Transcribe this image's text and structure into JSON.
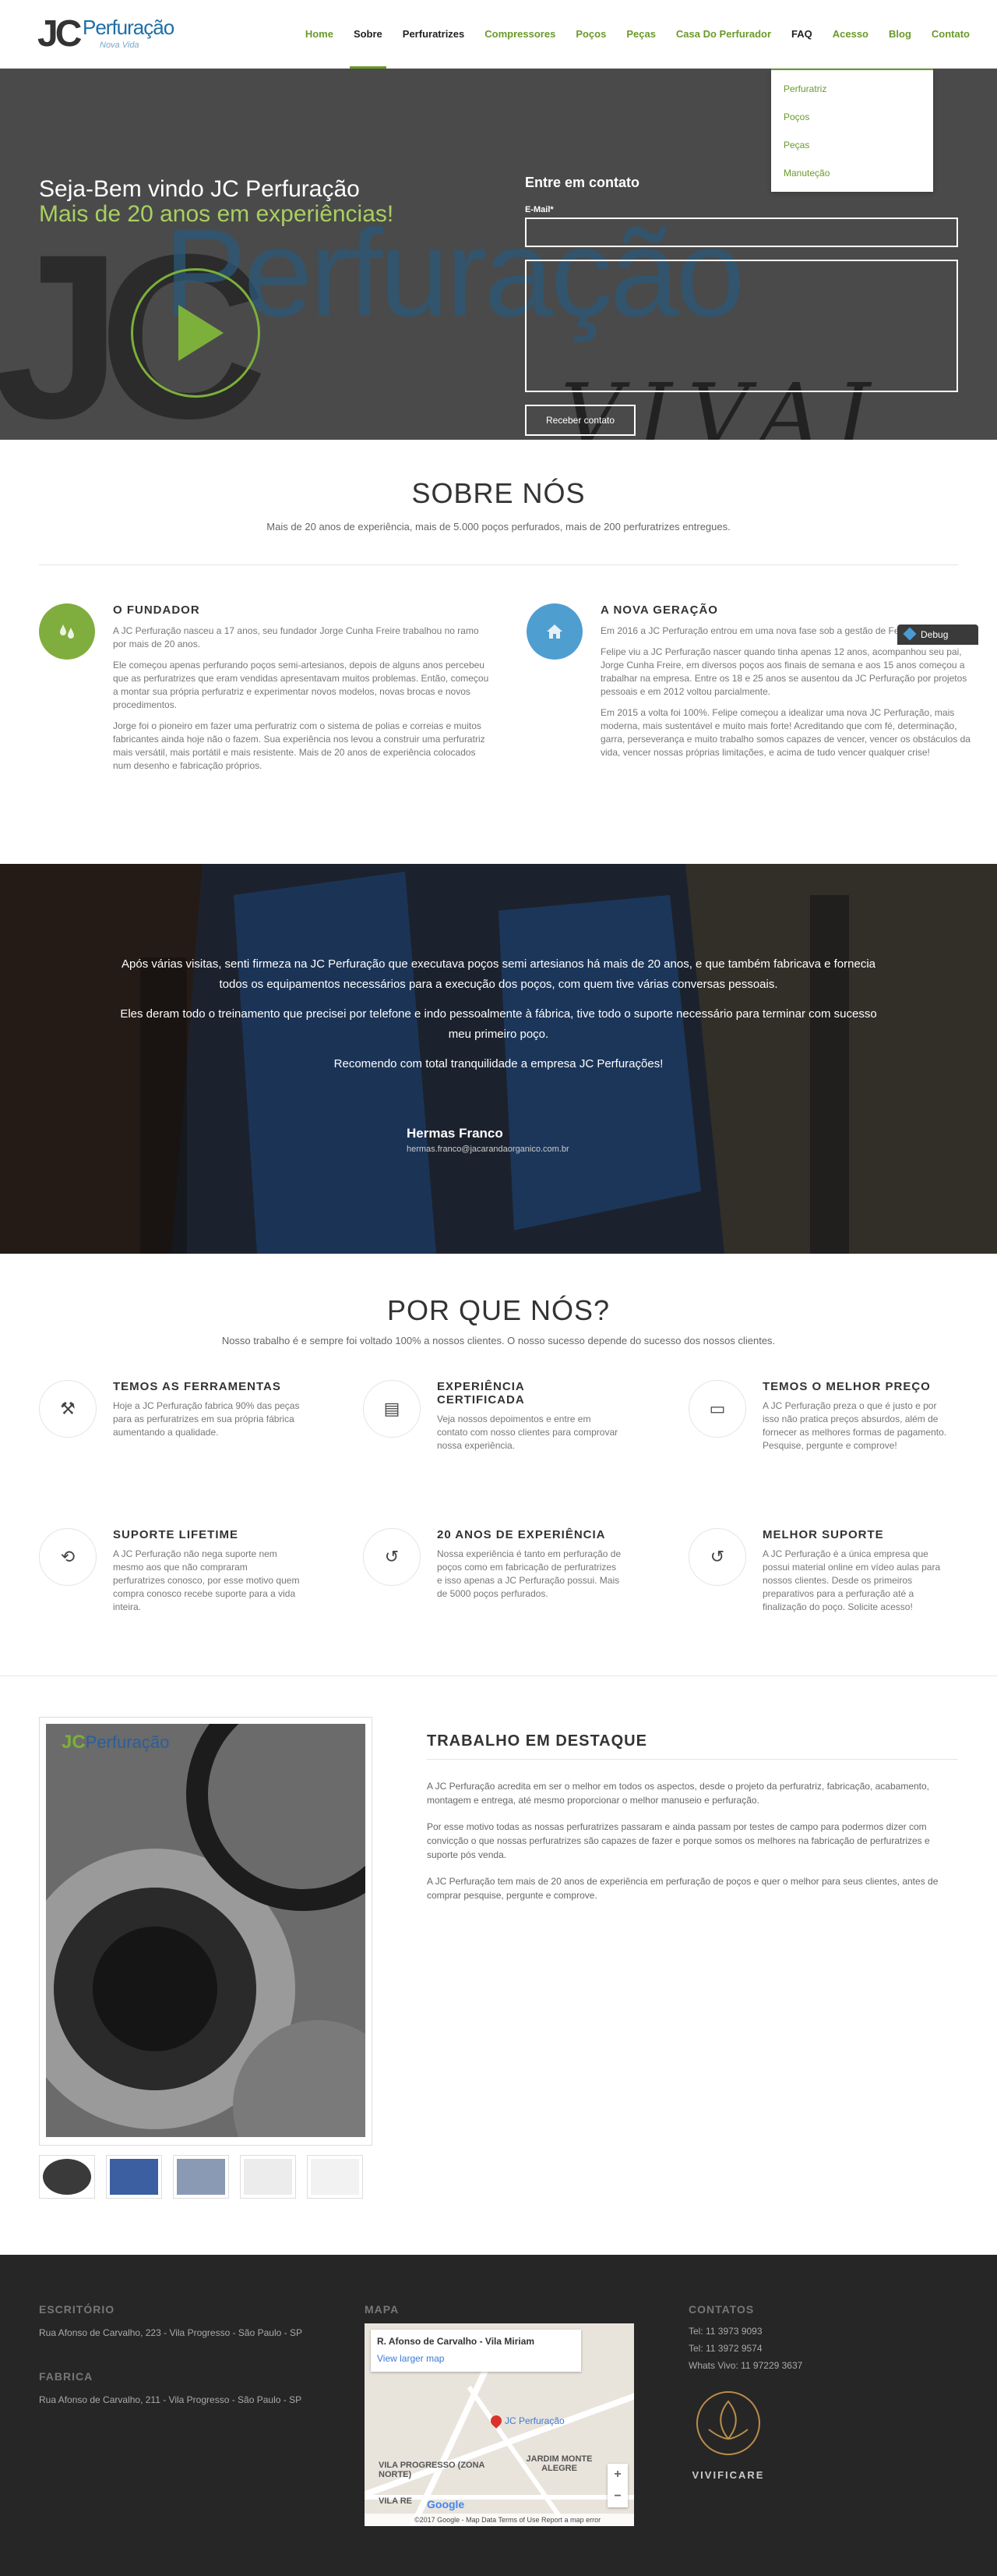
{
  "header": {
    "logo": {
      "jc": "JC",
      "brand": "Perfuração",
      "tagline": "Nova Vida"
    },
    "nav": [
      "Home",
      "Sobre",
      "Perfuratrizes",
      "Compressores",
      "Poços",
      "Peças",
      "Casa Do Perfurador",
      "FAQ",
      "Acesso",
      "Blog",
      "Contato"
    ],
    "active": "Sobre",
    "dropdown": [
      "Perfuratriz",
      "Poços",
      "Peças",
      "Manuteção"
    ]
  },
  "hero": {
    "line1": "Seja-Bem vindo JC Perfuração",
    "line2": "Mais de 20 anos em experiências!",
    "bg_brand": "Perfuração",
    "bg_jc": "JC",
    "bg_vivai": "VIVAI",
    "form": {
      "title": "Entre em contato",
      "email_label": "E-Mail*",
      "submit": "Receber contato"
    }
  },
  "debug_label": "Debug",
  "sobre": {
    "title": "SOBRE NÓS",
    "subtitle": "Mais de 20 anos de experiência, mais de 5.000 poços perfurados, mais de 200 perfuratrizes entregues.",
    "left": {
      "title": "O FUNDADOR",
      "p1": "A JC Perfuração nasceu a 17 anos, seu fundador Jorge Cunha Freire trabalhou no ramo por mais de 20 anos.",
      "p2": "Ele começou apenas perfurando poços semi-artesianos, depois de alguns anos percebeu que as perfuratrizes que eram vendidas apresentavam muitos problemas. Então, começou a montar sua própria perfuratriz e experimentar novos modelos, novas brocas e novos procedimentos.",
      "p3": "Jorge foi o pioneiro em fazer uma perfuratriz com o sistema de polias e correias e muitos fabricantes ainda hoje não o fazem. Sua experiência nos levou a construir uma perfuratriz mais versátil, mais portátil e mais resistente. Mais de 20 anos de experiência colocados num desenho e fabricação próprios."
    },
    "right": {
      "title": "A NOVA GERAÇÃO",
      "p1": "Em 2016 a JC Perfuração entrou em uma nova fase sob a gestão de Felipe Freire.",
      "p2": "Felipe viu a JC Perfuração nascer quando tinha apenas 12 anos, acompanhou seu pai, Jorge Cunha Freire, em diversos poços aos finais de semana e aos 15 anos começou a trabalhar na empresa. Entre os 18 e 25 anos se ausentou da JC Perfuração por projetos pessoais e em 2012 voltou parcialmente.",
      "p3": "Em 2015 a volta foi 100%. Felipe começou a idealizar uma nova JC Perfuração, mais moderna, mais sustentável e muito mais forte! Acreditando que com fé, determinação, garra, perseverança e muito trabalho somos capazes de vencer, vencer os obstáculos da vida, vencer nossas próprias limitações, e acima de tudo vencer qualquer crise!"
    }
  },
  "testimonial": {
    "p1": "Após várias visitas, senti firmeza na JC Perfuração que executava poços semi artesianos há mais de 20 anos, e que também fabricava e fornecia todos os equipamentos necessários para a execução dos poços, com quem tive várias conversas pessoais.",
    "p2": "Eles deram todo o treinamento que precisei por telefone e indo pessoalmente à fábrica, tive todo o suporte necessário para terminar com sucesso meu primeiro poço.",
    "p3": "Recomendo com total tranquilidade a empresa JC Perfurações!",
    "name": "Hermas Franco",
    "email": "hermas.franco@jacarandaorganico.com.br"
  },
  "why": {
    "title": "POR QUE NÓS?",
    "subtitle": "Nosso trabalho é e sempre foi voltado 100% a nossos clientes. O nosso sucesso depende do sucesso dos nossos clientes.",
    "features": [
      {
        "icon": "tools-icon",
        "glyph": "⚒",
        "title": "TEMOS AS FERRAMENTAS",
        "text": "Hoje a JC Perfuração fabrica 90% das peças para as perfuratrizes em sua própria fábrica aumentando a qualidade."
      },
      {
        "icon": "certificate-icon",
        "glyph": "▤",
        "title": "EXPERIÊNCIA CERTIFICADA",
        "text": "Veja nossos depoimentos e entre em contato com nosso clientes para comprovar nossa experiência."
      },
      {
        "icon": "card-icon",
        "glyph": "▭",
        "title": "TEMOS O MELHOR PREÇO",
        "text": "A JC Perfuração preza o que é justo e por isso não pratica preços absurdos, além de fornecer as melhores formas de pagamento. Pesquise, pergunte e comprove!"
      },
      {
        "icon": "repeat-icon",
        "glyph": "⟲",
        "title": "SUPORTE LIFETIME",
        "text": "A JC Perfuração não nega suporte nem mesmo aos que não compraram perfuratrizes conosco, por esse motivo quem compra conosco recebe suporte para a vida inteira."
      },
      {
        "icon": "history-icon",
        "glyph": "↺",
        "title": "20 ANOS DE EXPERIÊNCIA",
        "text": "Nossa experiência é tanto em perfuração de poços como em fabricação de perfuratrizes e isso apenas a JC Perfuração possui. Mais de 5000 poços perfurados."
      },
      {
        "icon": "history-icon",
        "glyph": "↺",
        "title": "MELHOR SUPORTE",
        "text": "A JC Perfuração é a única empresa que possui material online em vídeo aulas para nossos clientes. Desde os primeiros preparativos para a perfuração até a finalização do poço. Solicite acesso!"
      }
    ]
  },
  "featured": {
    "title": "TRABALHO EM DESTAQUE",
    "photo_logo_jc": "JC",
    "photo_logo_brand": "Perfuração",
    "p1": "A JC Perfuração acredita em ser o melhor em todos os aspectos, desde o projeto da perfuratriz, fabricação, acabamento, montagem e entrega, até mesmo proporcionar o melhor manuseio e perfuração.",
    "p2": "Por esse motivo todas as nossas perfuratrizes passaram e ainda passam por testes de campo para podermos dizer com convicção o que nossas perfuratrizes são capazes de fazer e porque somos os melhores na fabricação de perfuratrizes e suporte pós venda.",
    "p3": "A JC Perfuração tem mais de 20 anos de experiência em perfuração de poços e quer o melhor para seus clientes, antes de comprar pesquise, pergunte e comprove."
  },
  "footer": {
    "escritorio": {
      "title": "ESCRITÓRIO",
      "text": "Rua Afonso de Carvalho, 223 - Vila Progresso - São Paulo - SP"
    },
    "fabrica": {
      "title": "FABRICA",
      "text": "Rua Afonso de Carvalho, 211 - Vila Progresso - São Paulo - SP"
    },
    "mapa": {
      "title": "MAPA",
      "place": "R. Afonso de Carvalho - Vila Miriam",
      "larger": "View larger map",
      "pin_label": "JC Perfuração",
      "area1": "VILA PROGRESSO (ZONA NORTE)",
      "area2": "JARDIM MONTE ALEGRE",
      "area3": "VILA RE",
      "google": "Google",
      "credits": "©2017 Google - Map Data    Terms of Use    Report a map error"
    },
    "contatos": {
      "title": "CONTATOS",
      "tel1": "Tel: 11 3973 9093",
      "tel2": "Tel: 11 3972 9574",
      "whats": "Whats Vivo: 11 97229 3637",
      "badge": "VIVIFICARE"
    }
  }
}
